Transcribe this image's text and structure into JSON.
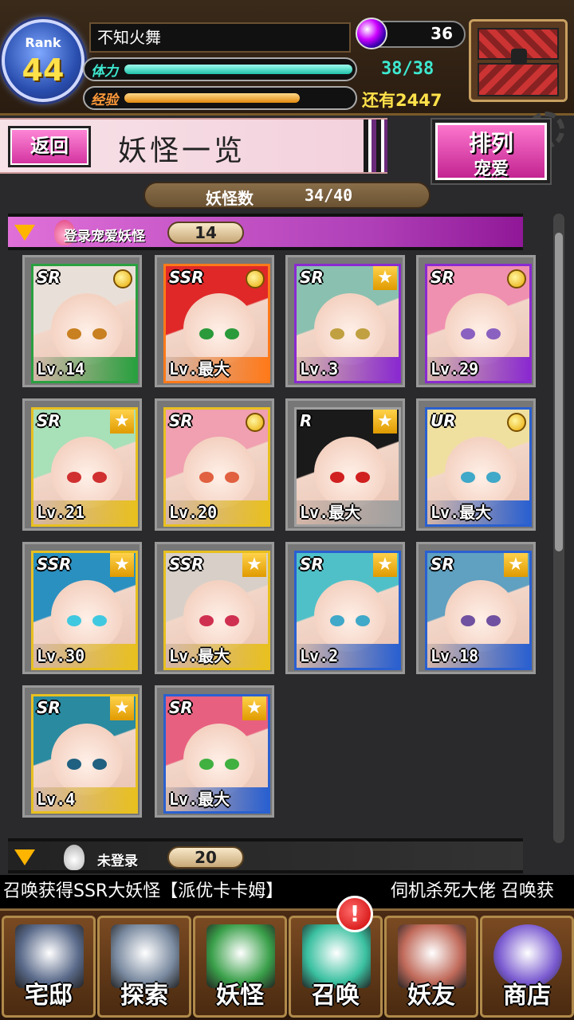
{
  "player": {
    "rank_label": "Rank",
    "rank": "44",
    "name": "不知火舞",
    "hp_label": "体力",
    "hp_text": "38/38",
    "hp_fraction": 1.0,
    "xp_label": "经验",
    "xp_fraction": 0.77,
    "xp_remain": "还有2447",
    "gems": "36"
  },
  "header": {
    "back": "返回",
    "title": "妖怪一览",
    "sort_line1": "排列",
    "sort_line2": "宠爱"
  },
  "count": {
    "label": "妖怪数",
    "value": "34/40"
  },
  "sections": {
    "favorites": {
      "label": "登录宠爱妖怪",
      "count": "14"
    },
    "unregistered": {
      "label": "未登录",
      "count": "20"
    }
  },
  "monsters": [
    {
      "rarity": "SR",
      "level": "Lv.14",
      "badge": "medal",
      "frame": "#2aa040",
      "hair": "#e8e0d8",
      "eye": "#c88020"
    },
    {
      "rarity": "SSR",
      "level": "Lv.最大",
      "badge": "medal",
      "frame": "#ff7a1a",
      "hair": "#e02828",
      "eye": "#2a9a3a"
    },
    {
      "rarity": "SR",
      "level": "Lv.3",
      "badge": "star",
      "frame": "#8a2ad0",
      "hair": "#8ac0b0",
      "eye": "#c0a040"
    },
    {
      "rarity": "SR",
      "level": "Lv.29",
      "badge": "medal",
      "frame": "#8a2ad0",
      "hair": "#f090b0",
      "eye": "#8a60c0"
    },
    {
      "rarity": "SR",
      "level": "Lv.21",
      "badge": "star",
      "frame": "#e8c020",
      "hair": "#a8e0b8",
      "eye": "#d03030"
    },
    {
      "rarity": "SR",
      "level": "Lv.20",
      "badge": "medal",
      "frame": "#e8c020",
      "hair": "#f0a0b0",
      "eye": "#e06040"
    },
    {
      "rarity": "R",
      "level": "Lv.最大",
      "badge": "star",
      "frame": "#a0a0a0",
      "hair": "#1a1a1a",
      "eye": "#d02020"
    },
    {
      "rarity": "UR",
      "level": "Lv.最大",
      "badge": "medal",
      "frame": "#2a60d0",
      "hair": "#f0e0a0",
      "eye": "#40a8c8"
    },
    {
      "rarity": "SSR",
      "level": "Lv.30",
      "badge": "star",
      "frame": "#e8c020",
      "hair": "#2a90c0",
      "eye": "#40c8e0"
    },
    {
      "rarity": "SSR",
      "level": "Lv.最大",
      "badge": "star",
      "frame": "#e8c020",
      "hair": "#d8d0c8",
      "eye": "#d03050"
    },
    {
      "rarity": "SR",
      "level": "Lv.2",
      "badge": "star",
      "frame": "#2a60d0",
      "hair": "#50c0c8",
      "eye": "#40a8c8"
    },
    {
      "rarity": "SR",
      "level": "Lv.18",
      "badge": "star",
      "frame": "#2a60d0",
      "hair": "#60a0c0",
      "eye": "#7050a0"
    },
    {
      "rarity": "SR",
      "level": "Lv.4",
      "badge": "star",
      "frame": "#e8c020",
      "hair": "#2a8aa0",
      "eye": "#206080"
    },
    {
      "rarity": "SR",
      "level": "Lv.最大",
      "badge": "star",
      "frame": "#2a60d0",
      "hair": "#e86080",
      "eye": "#40b040"
    }
  ],
  "ticker": {
    "msg1": "召唤获得SSR大妖怪【派优卡卡姆】",
    "msg2": "伺机杀死大佬 召唤获"
  },
  "nav": [
    {
      "label": "宅邸",
      "icon": "house-icon",
      "color": "#5a6a8a"
    },
    {
      "label": "探索",
      "icon": "magnifier-icon",
      "color": "#7a8aa0"
    },
    {
      "label": "妖怪",
      "icon": "scroll-icon",
      "color": "#3aa04a"
    },
    {
      "label": "召唤",
      "icon": "pentagram-icon",
      "color": "#3ac0a0"
    },
    {
      "label": "妖友",
      "icon": "friend-icon",
      "color": "#c06a5a"
    },
    {
      "label": "商店",
      "icon": "orb-icon",
      "color": "#7a5ad0"
    }
  ],
  "alert": "!"
}
